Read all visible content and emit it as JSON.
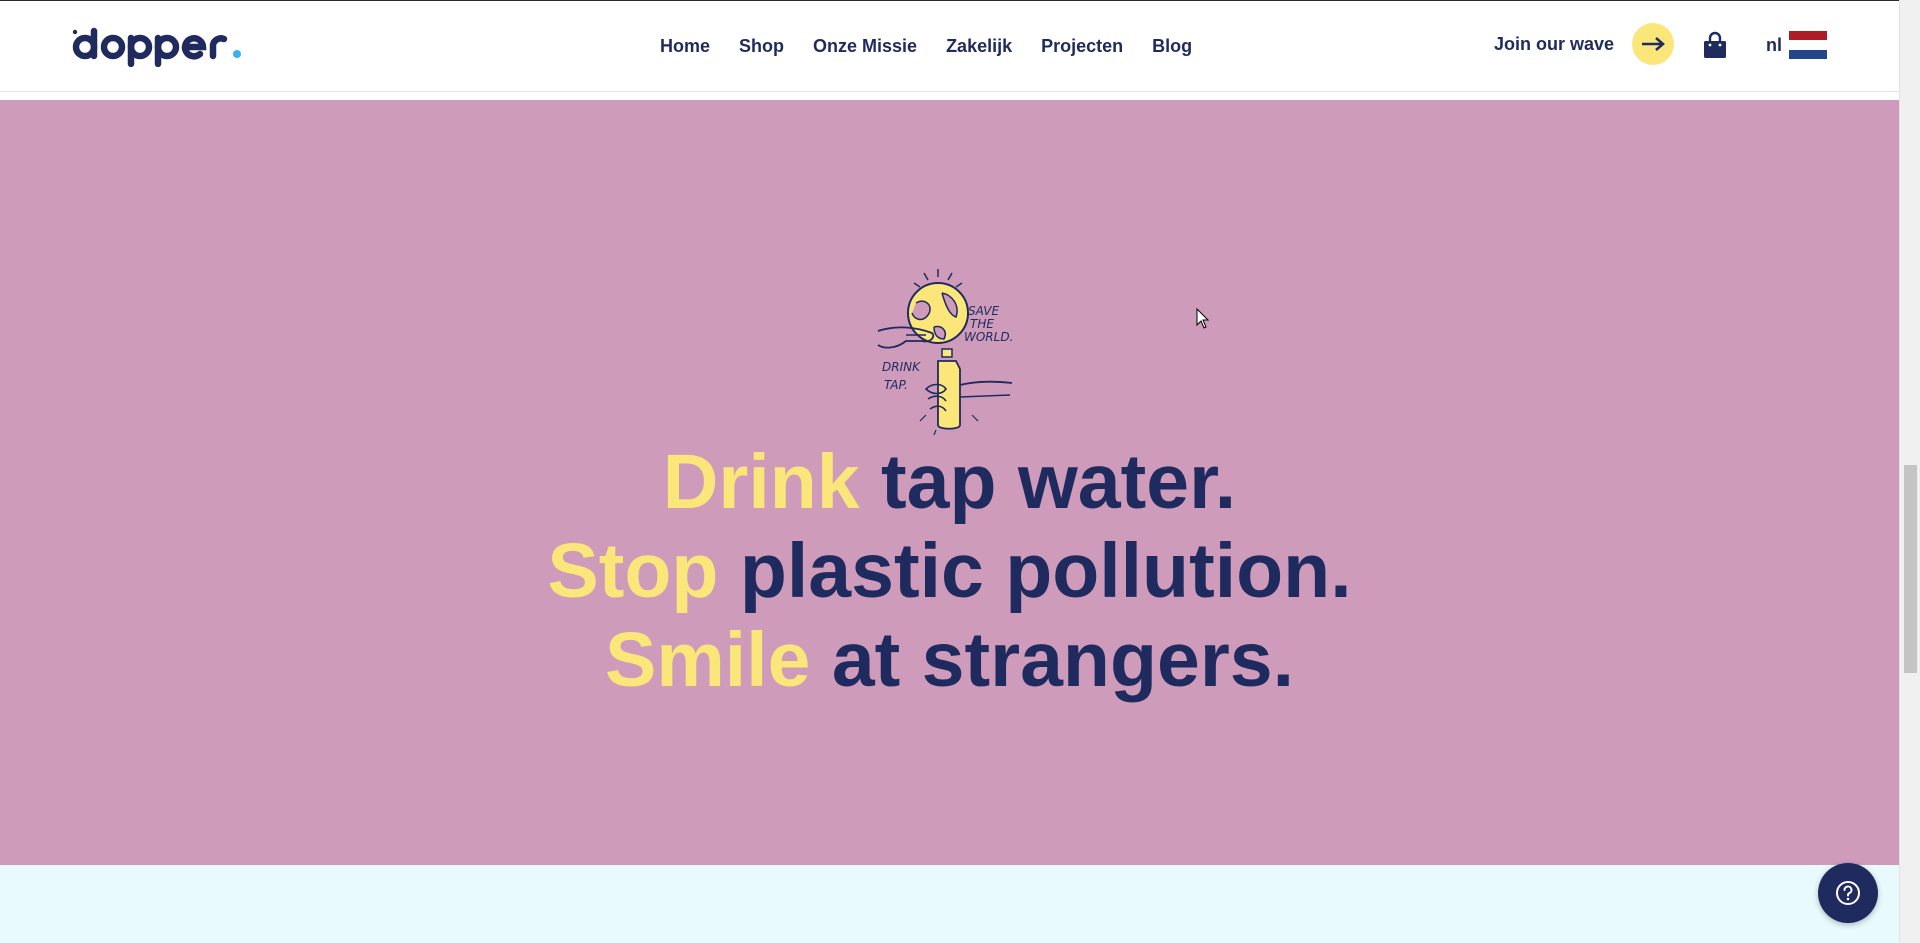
{
  "brand": {
    "logo_text": "dopper",
    "navy": "#1f2a5e",
    "yellow": "#fbe67a",
    "hero_bg": "#ce9bbb",
    "next_section_bg": "#e8fafc"
  },
  "nav": {
    "items": [
      {
        "label": "Home"
      },
      {
        "label": "Shop"
      },
      {
        "label": "Onze Missie"
      },
      {
        "label": "Zakelijk"
      },
      {
        "label": "Projecten"
      },
      {
        "label": "Blog"
      }
    ]
  },
  "header_actions": {
    "join_label": "Join our wave",
    "join_icon": "arrow-right-icon",
    "cart_icon": "shopping-bag-icon",
    "language_code": "nl",
    "language_flag": "netherlands-flag-icon"
  },
  "hero": {
    "illustration_text": [
      "SAVE",
      "THE",
      "WORLD.",
      "DRINK",
      "TAP."
    ],
    "lines": [
      {
        "highlight": "Drink",
        "rest": "tap water."
      },
      {
        "highlight": "Stop",
        "rest": "plastic pollution."
      },
      {
        "highlight": "Smile",
        "rest": "at strangers."
      }
    ]
  },
  "help": {
    "icon": "question-mark-icon"
  }
}
